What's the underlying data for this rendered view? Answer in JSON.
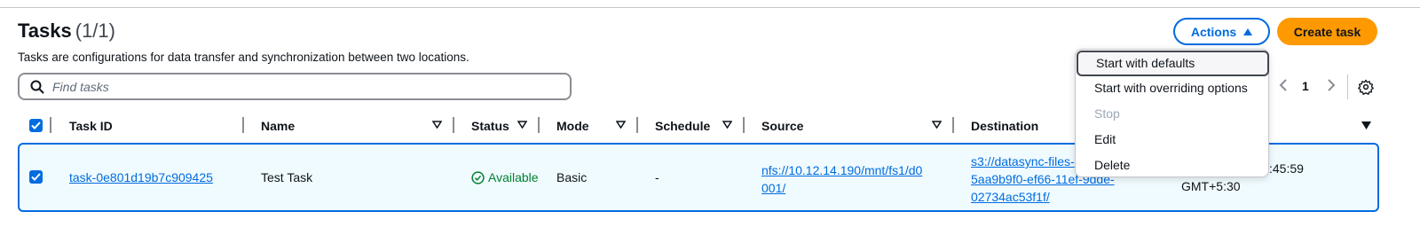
{
  "header": {
    "title": "Tasks",
    "count": "(1/1)",
    "description": "Tasks are configurations for data transfer and synchronization between two locations.",
    "actions_label": "Actions",
    "create_label": "Create task"
  },
  "search": {
    "placeholder": "Find tasks"
  },
  "pagination": {
    "current_page": "1"
  },
  "table": {
    "columns": [
      "Task ID",
      "Name",
      "Status",
      "Mode",
      "Schedule",
      "Source",
      "Destination"
    ],
    "rows": [
      {
        "task_id": "task-0e801d19b7c909425",
        "name": "Test Task",
        "status": "Available",
        "mode": "Basic",
        "schedule": "-",
        "source_line1": "nfs://10.12.14.190/mnt/fs1/d0",
        "source_line2": "001/",
        "dest_line1": "s3://datasync-files-",
        "dest_line2": "5aa9b9f0-ef66-11ef-9dde-",
        "dest_line3": "02734ac53f1f/",
        "extra_line1": ":45:59",
        "extra_line2": "GMT+5:30"
      }
    ]
  },
  "actions_menu": {
    "items": [
      "Start with defaults",
      "Start with overriding options",
      "Stop",
      "Edit",
      "Delete"
    ]
  },
  "colors": {
    "accent": "#006ce0",
    "primary_button": "#ff9900",
    "success": "#00802f"
  }
}
